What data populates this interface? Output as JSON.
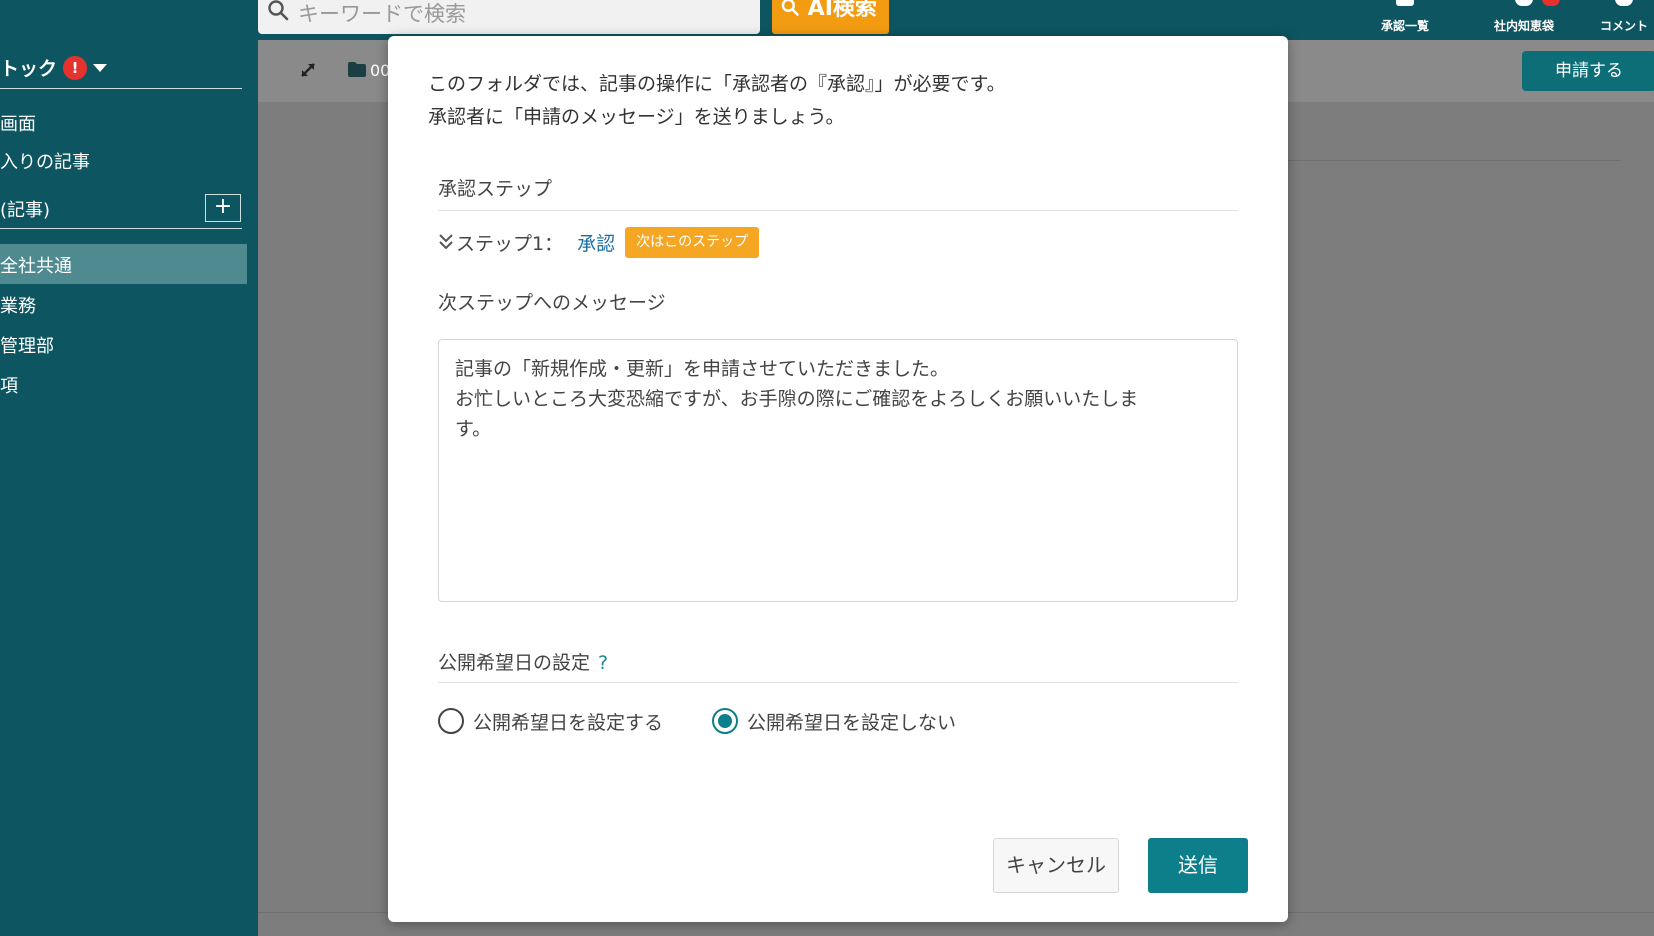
{
  "header": {
    "search_placeholder": "キーワードで検索",
    "ai_search_label": "AI検索",
    "nav": [
      {
        "label": "承認一覧",
        "icon": "approval-list-icon"
      },
      {
        "label": "社内知恵袋",
        "icon": "qa-icon"
      },
      {
        "label": "コメント",
        "icon": "comment-icon"
      }
    ]
  },
  "sidebar": {
    "title": "トック",
    "alert": "!",
    "items_top": [
      "画面",
      "入りの記事"
    ],
    "section_label": "(記事)",
    "add_label": "+",
    "folders": [
      "全社共通",
      "業務",
      "管理部",
      "項"
    ]
  },
  "toolbar": {
    "folder_label": "00",
    "apply_label": "申請する"
  },
  "modal": {
    "intro_line1": "このフォルダでは、記事の操作に「承認者の『承認』」が必要です。",
    "intro_line2": "承認者に「申請のメッセージ」を送りましょう。",
    "approval_steps_title": "承認ステップ",
    "step_label": "ステップ1：",
    "step_link": "承認",
    "step_badge": "次はこのステップ",
    "message_title": "次ステップへのメッセージ",
    "message_text": "記事の「新規作成・更新」を申請させていただきました。\nお忙しいところ大変恐縮ですが、お手隙の際にご確認をよろしくお願いいたしま\nす。",
    "publish_date_title": "公開希望日の設定",
    "help_mark": "?",
    "radio_options": [
      {
        "label": "公開希望日を設定する",
        "checked": false
      },
      {
        "label": "公開希望日を設定しない",
        "checked": true
      }
    ],
    "cancel_label": "キャンセル",
    "send_label": "送信"
  },
  "colors": {
    "header_bg": "#0d5560",
    "accent": "#0d7f8a",
    "ai_button": "#f39c12",
    "badge": "#f5a623",
    "link": "#1a6fa3"
  }
}
